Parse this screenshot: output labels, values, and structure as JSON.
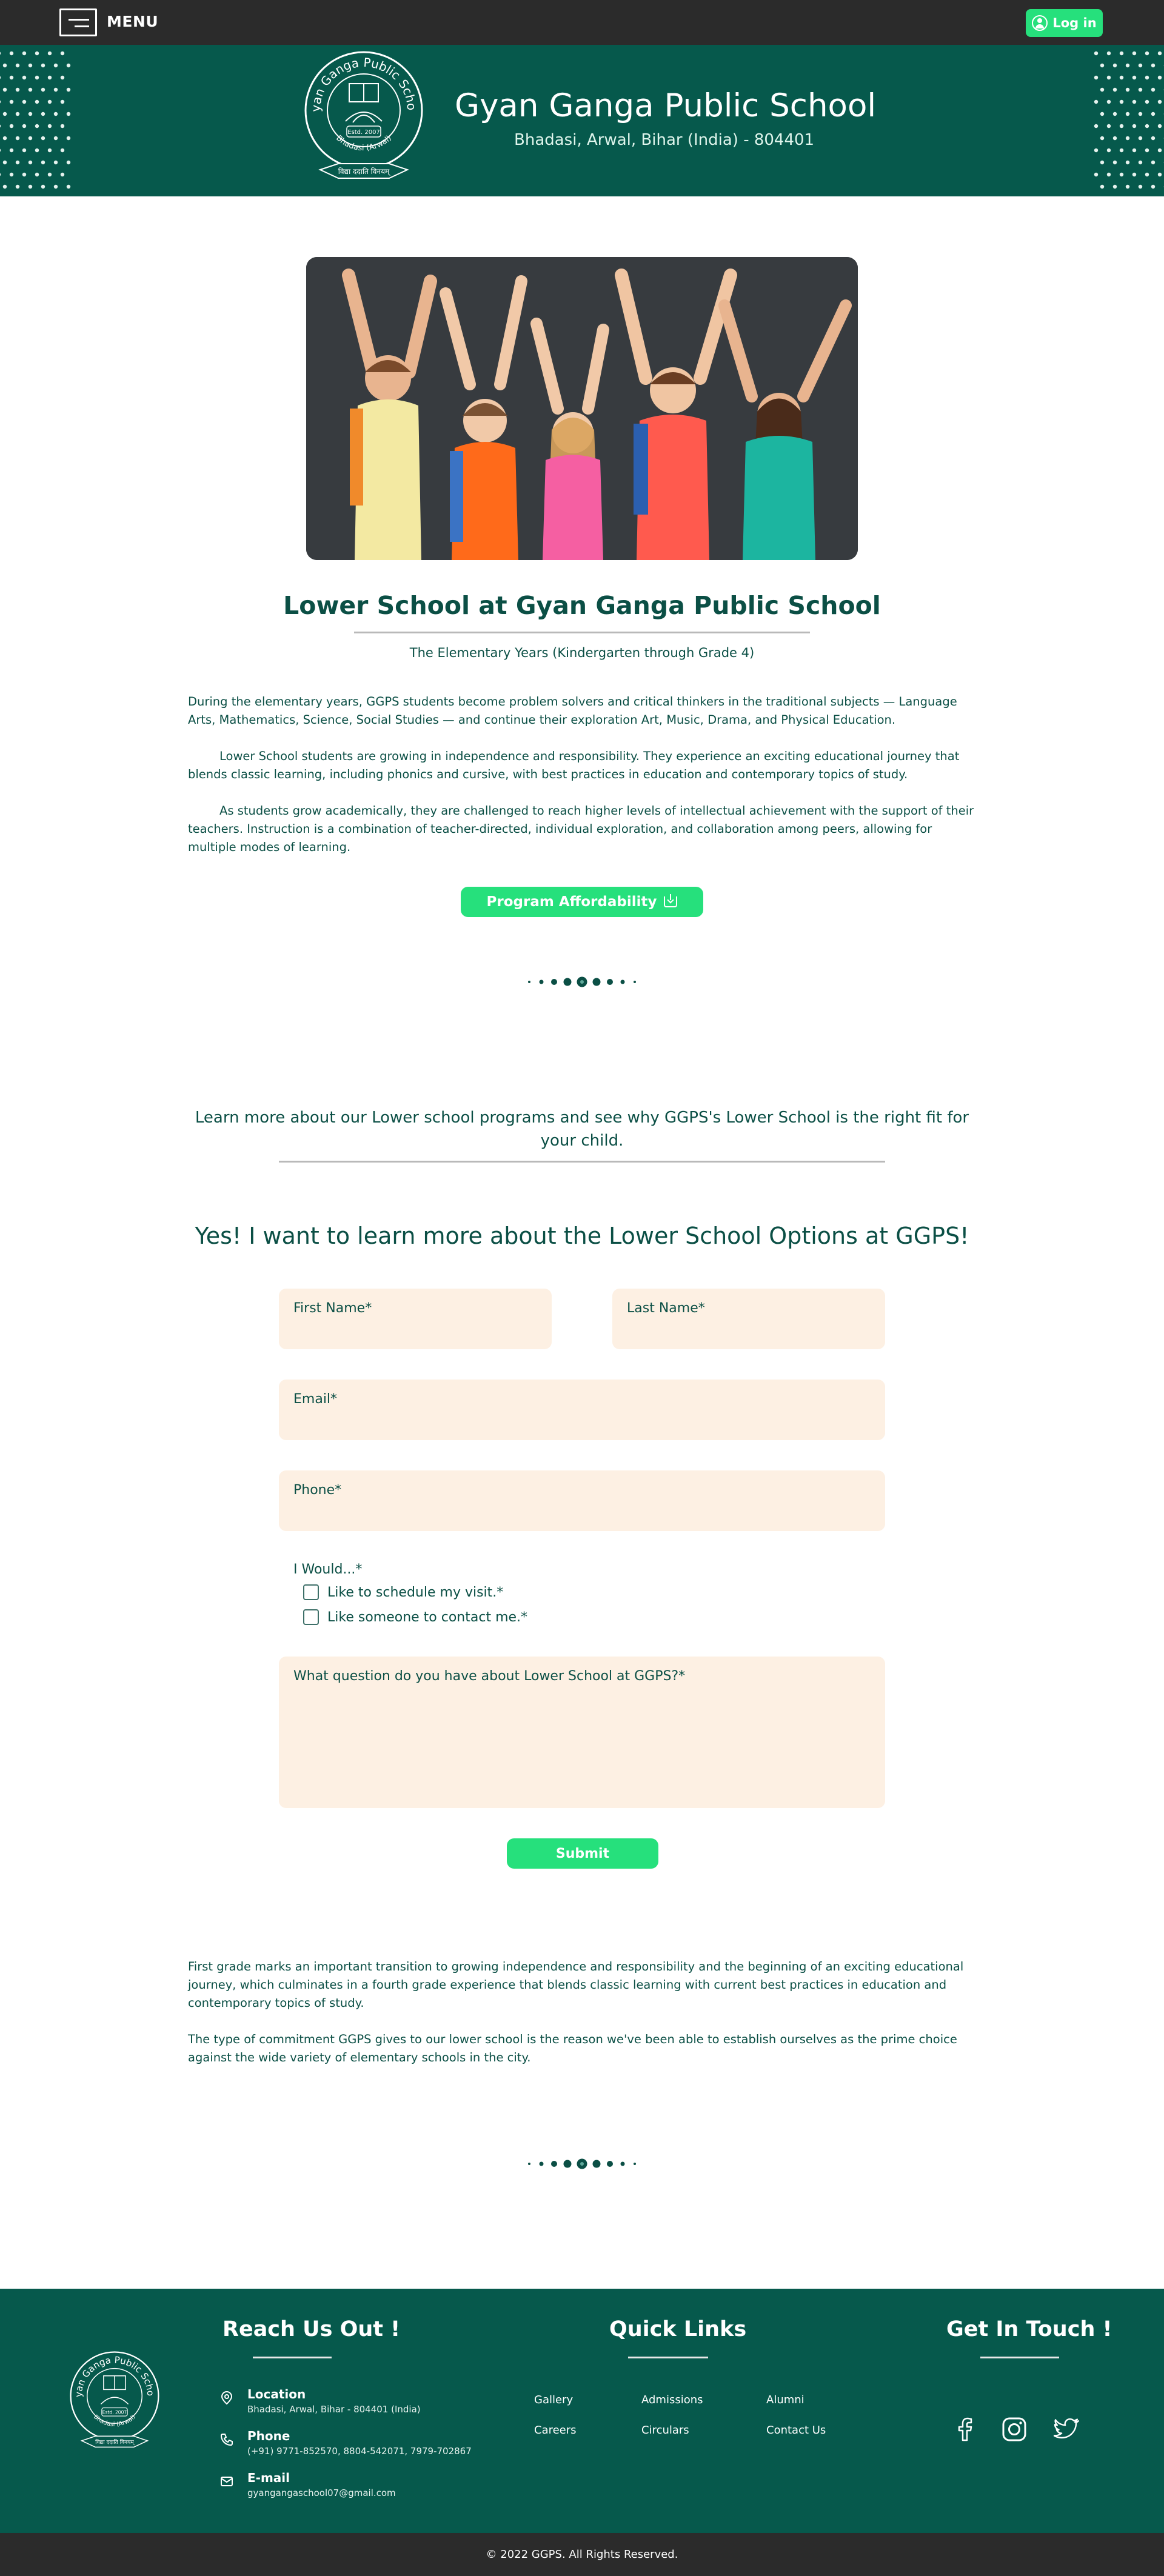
{
  "topbar": {
    "menu_label": "MENU",
    "login_label": "Log in"
  },
  "header": {
    "logo_text_top": "Gyan Ganga Public School",
    "logo_estd": "Estd. 2007",
    "logo_place": "Bhadasi (Arwal)",
    "logo_motto": "विद्या ददाति विनयम्",
    "school_name": "Gyan Ganga Public School",
    "address": "Bhadasi, Arwal, Bihar (India) - 804401"
  },
  "main": {
    "title": "Lower School at Gyan Ganga Public School",
    "subtitle": "The Elementary Years (Kindergarten through Grade 4)",
    "paragraphs": [
      "During the elementary years, GGPS students become problem solvers and critical thinkers in the traditional subjects — Language Arts, Mathematics, Science, Social Studies — and continue their exploration Art, Music, Drama, and Physical Education.",
      "Lower School students are growing in independence and responsibility. They experience an exciting educational journey that blends classic learning, including phonics and cursive, with best practices in education and contemporary topics of study.",
      "As students grow academically, they are challenged to reach higher levels of intellectual achievement with the support of their teachers. Instruction is a combination of teacher-directed, individual exploration, and collaboration among peers, allowing for multiple modes of learning."
    ],
    "afford_button": "Program Affordability",
    "learn_more": "Learn more about our Lower school programs and see why GGPS's Lower School is the right fit for your child."
  },
  "form": {
    "title": "Yes! I want to learn more about the Lower School Options at GGPS!",
    "first_name": "First Name*",
    "last_name": "Last Name*",
    "email": "Email*",
    "phone": "Phone*",
    "would_label": "I Would...*",
    "option_visit": "Like to schedule my visit.*",
    "option_contact": "Like someone to contact me.*",
    "question": "What question do you have about Lower School at GGPS?*",
    "submit": "Submit"
  },
  "closing": {
    "paragraphs": [
      "First grade marks an important transition to growing independence and responsibility and the beginning of an exciting educational journey, which culminates in a fourth grade experience that blends classic learning with current best practices in education and contemporary topics of study.",
      "The type of commitment GGPS gives to our lower school is the reason we've been able to establish ourselves as the prime choice against the wide variety of elementary schools in the city."
    ]
  },
  "footer": {
    "reach_title": "Reach Us Out !",
    "quick_title": "Quick Links",
    "touch_title": "Get In Touch !",
    "location_label": "Location",
    "location_value": "Bhadasi, Arwal, Bihar - 804401 (India)",
    "phone_label": "Phone",
    "phone_value": "(+91) 9771-852570, 8804-542071, 7979-702867",
    "email_label": "E-mail",
    "email_value": "gyangangaschool07@gmail.com",
    "links": [
      "Gallery",
      "Admissions",
      "Alumni",
      "Careers",
      "Circulars",
      "Contact Us"
    ],
    "copyright": "© 2022 GGPS. All Rights Reserved."
  },
  "colors": {
    "brand_green": "#06594c",
    "accent_green": "#26e07c",
    "field_bg": "#fdf0e3",
    "dark_bar": "#2b2b2b"
  }
}
